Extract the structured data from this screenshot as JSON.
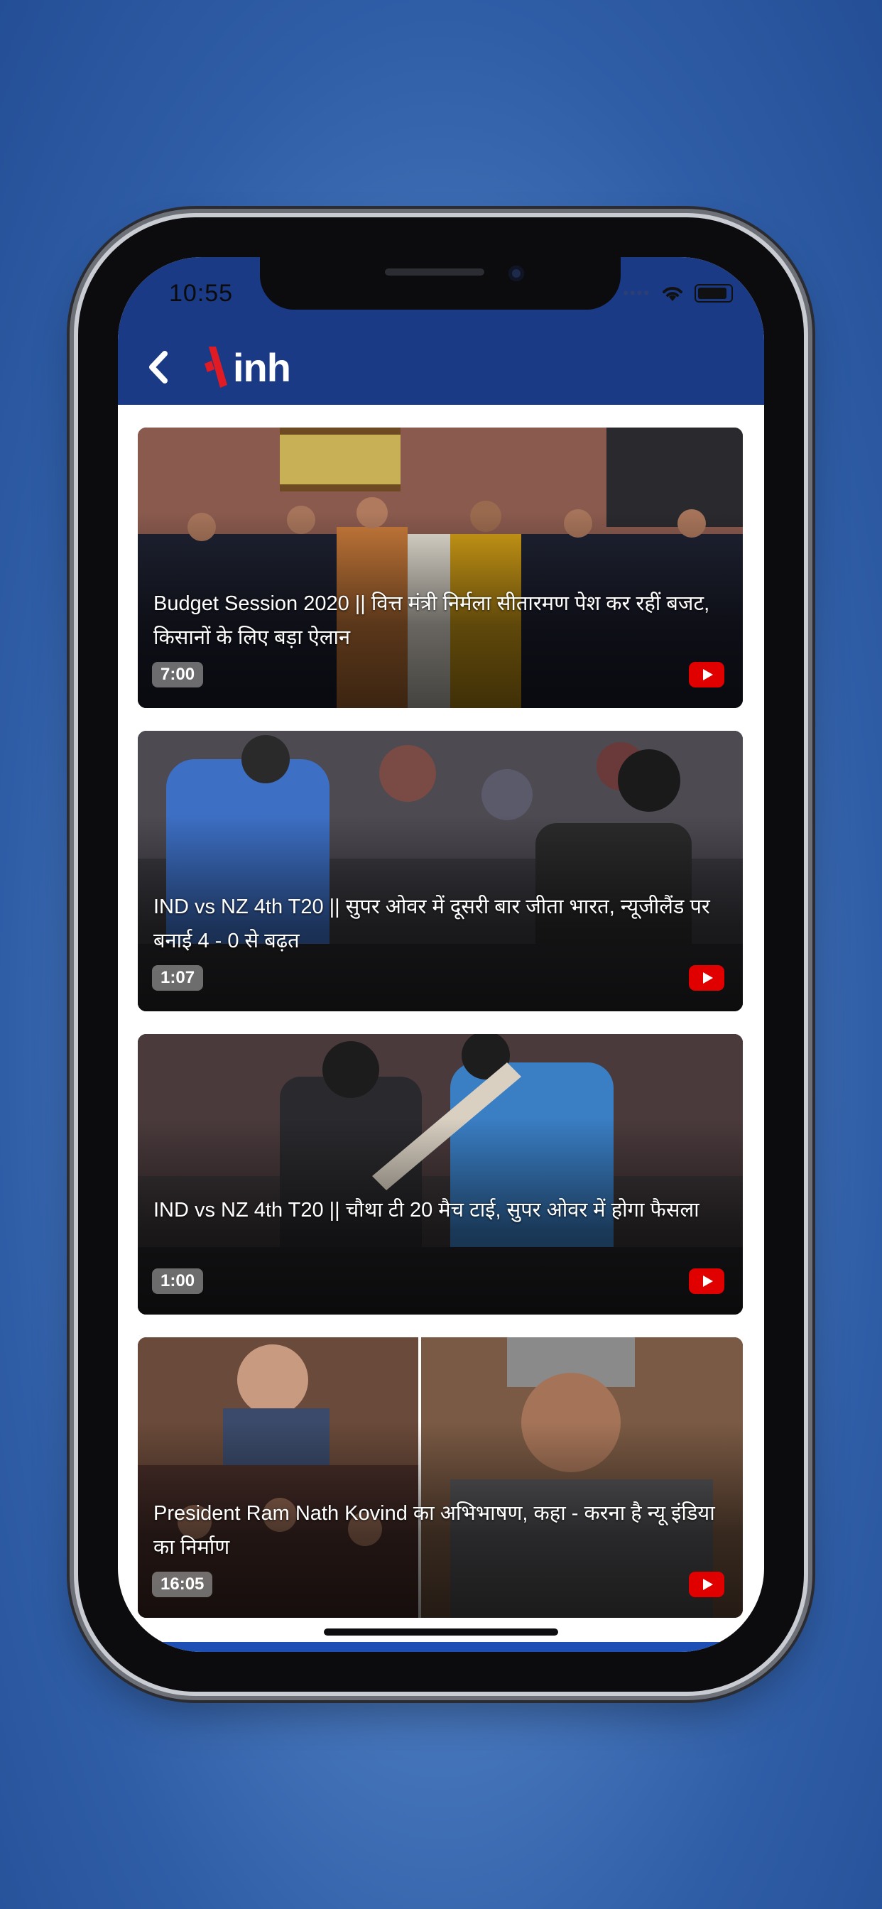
{
  "status_bar": {
    "time": "10:55"
  },
  "header": {
    "logo_text": "inh"
  },
  "videos": [
    {
      "title": "Budget Session 2020 || वित्त मंत्री निर्मला सीतारमण पेश कर रहीं बजट, किसानों के लिए बड़ा ऐलान",
      "duration": "7:00"
    },
    {
      "title": "IND vs NZ 4th T20 || सुपर ओवर में दूसरी बार जीता भारत, न्यूजीलैंड पर बनाई 4 - 0 से बढ़त",
      "duration": "1:07"
    },
    {
      "title": "IND vs NZ 4th T20 || चौथा टी 20 मैच टाई, सुपर ओवर में होगा फैसला",
      "duration": "1:00"
    },
    {
      "title": "President Ram Nath Kovind का अभिभाषण, कहा - करना है न्यू इंडिया का निर्माण",
      "duration": "16:05"
    }
  ],
  "colors": {
    "header_bg": "#1b3a86",
    "brand_red": "#e01b24",
    "youtube_red": "#e00000"
  },
  "icons": {
    "back": "back-chevron-icon",
    "play": "youtube-play-icon",
    "wifi": "wifi-icon",
    "battery": "battery-icon"
  }
}
